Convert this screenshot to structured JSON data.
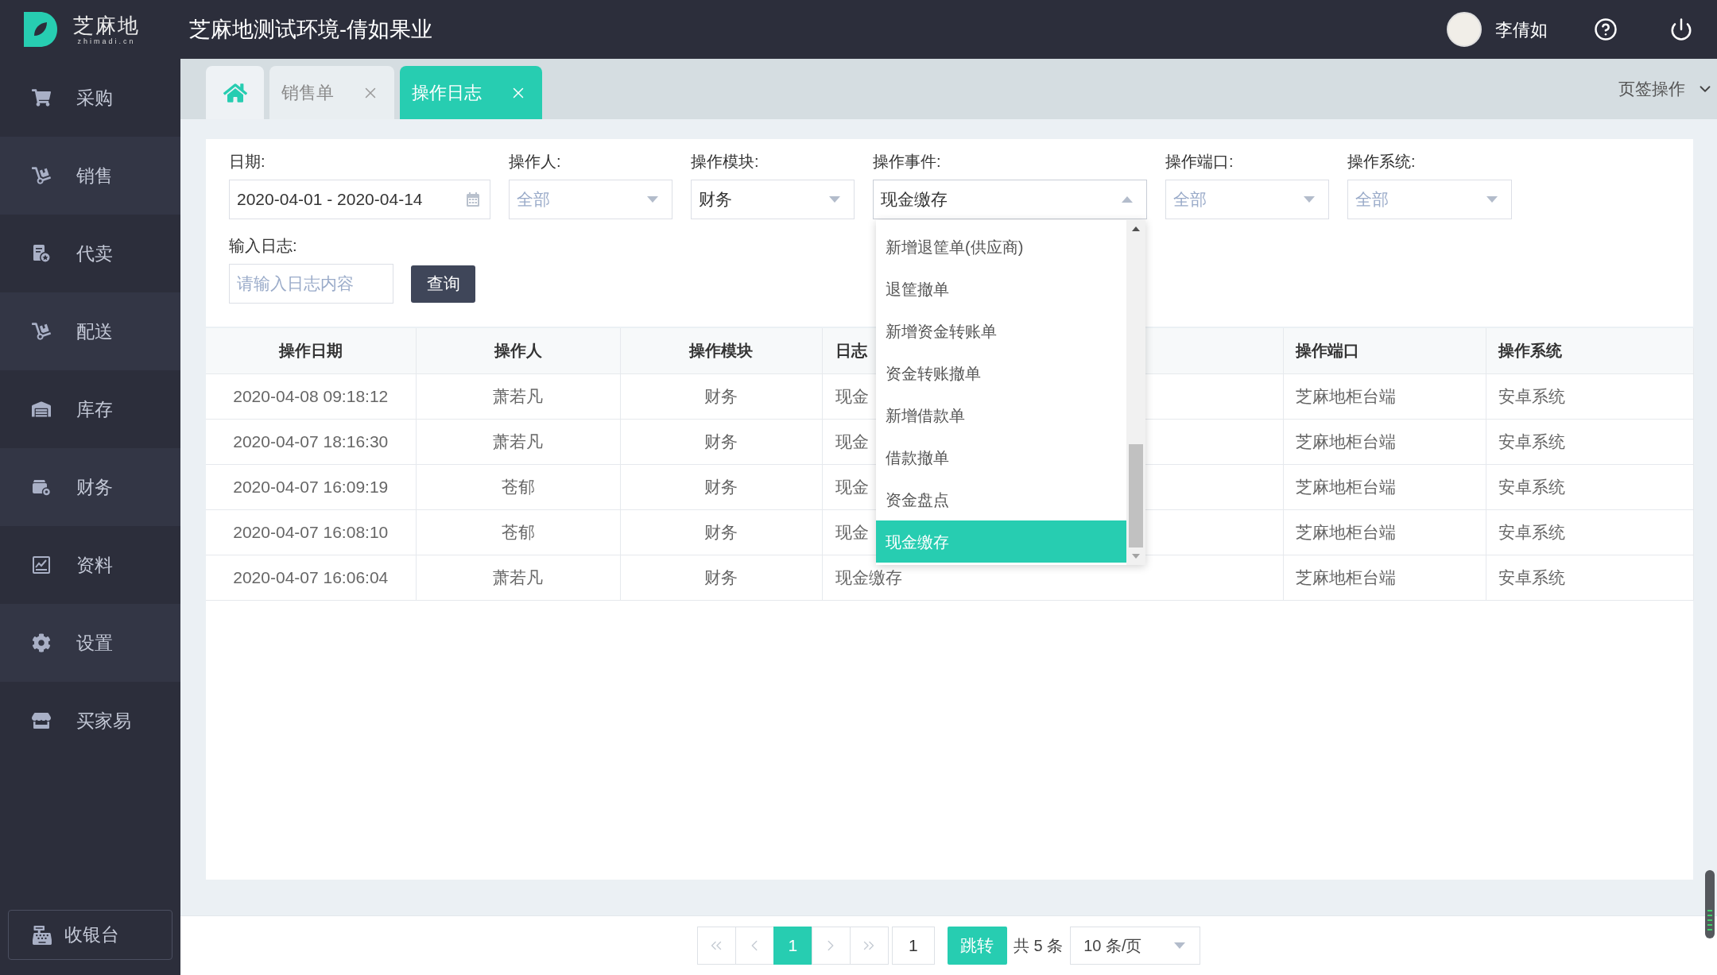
{
  "header": {
    "logo_name": "芝麻地",
    "logo_domain": "zhimadi.cn",
    "title": "芝麻地测试环境-倩如果业",
    "user_name": "李倩如"
  },
  "sidebar": {
    "items": [
      {
        "label": "采购"
      },
      {
        "label": "销售"
      },
      {
        "label": "代卖"
      },
      {
        "label": "配送"
      },
      {
        "label": "库存"
      },
      {
        "label": "财务"
      },
      {
        "label": "资料"
      },
      {
        "label": "设置"
      },
      {
        "label": "买家易"
      }
    ],
    "cashier_button": "收银台"
  },
  "tabs": [
    {
      "kind": "home",
      "selected": false
    },
    {
      "kind": "page",
      "label": "销售单",
      "selected": false
    },
    {
      "kind": "page",
      "label": "操作日志",
      "selected": true
    }
  ],
  "tab_menu": "页签操作",
  "filters": [
    {
      "kind": "date",
      "label": "日期:",
      "value": "2020-04-01 - 2020-04-14"
    },
    {
      "kind": "select",
      "label": "操作人:",
      "placeholder": "全部",
      "expanded": false
    },
    {
      "kind": "select",
      "label": "操作模块:",
      "value": "财务",
      "expanded": false
    },
    {
      "kind": "select",
      "label": "操作事件:",
      "value": "现金缴存",
      "expanded": true,
      "options": [
        {
          "label": "新增退筐单(供应商)",
          "selected": false
        },
        {
          "label": "退筐撤单",
          "selected": false
        },
        {
          "label": "新增资金转账单",
          "selected": false
        },
        {
          "label": "资金转账撤单",
          "selected": false
        },
        {
          "label": "新增借款单",
          "selected": false
        },
        {
          "label": "借款撤单",
          "selected": false
        },
        {
          "label": "资金盘点",
          "selected": false
        },
        {
          "label": "现金缴存",
          "selected": true
        }
      ]
    },
    {
      "kind": "select",
      "label": "操作端口:",
      "placeholder": "全部",
      "expanded": false
    },
    {
      "kind": "select",
      "label": "操作系统:",
      "placeholder": "全部",
      "expanded": false
    }
  ],
  "log_search": {
    "label": "输入日志:",
    "placeholder": "请输入日志内容"
  },
  "query_button": "查询",
  "table": {
    "columns": [
      "操作日期",
      "操作人",
      "操作模块",
      "日志",
      "操作端口",
      "操作系统"
    ],
    "rows": [
      [
        "2020-04-08 09:18:12",
        "萧若凡",
        "财务",
        "现金",
        "芝麻地柜台端",
        "安卓系统"
      ],
      [
        "2020-04-07 18:16:30",
        "萧若凡",
        "财务",
        "现金",
        "芝麻地柜台端",
        "安卓系统"
      ],
      [
        "2020-04-07 16:09:19",
        "苍郁",
        "财务",
        "现金",
        "芝麻地柜台端",
        "安卓系统"
      ],
      [
        "2020-04-07 16:08:10",
        "苍郁",
        "财务",
        "现金",
        "芝麻地柜台端",
        "安卓系统"
      ],
      [
        "2020-04-07 16:06:04",
        "萧若凡",
        "财务",
        "现金缴存",
        "芝麻地柜台端",
        "安卓系统"
      ]
    ]
  },
  "pagination": {
    "pages": [
      {
        "label": "1",
        "selected": true
      }
    ],
    "jump_value": "1",
    "jump_button": "跳转",
    "total": "共 5 条",
    "page_size": "10 条/页"
  }
}
